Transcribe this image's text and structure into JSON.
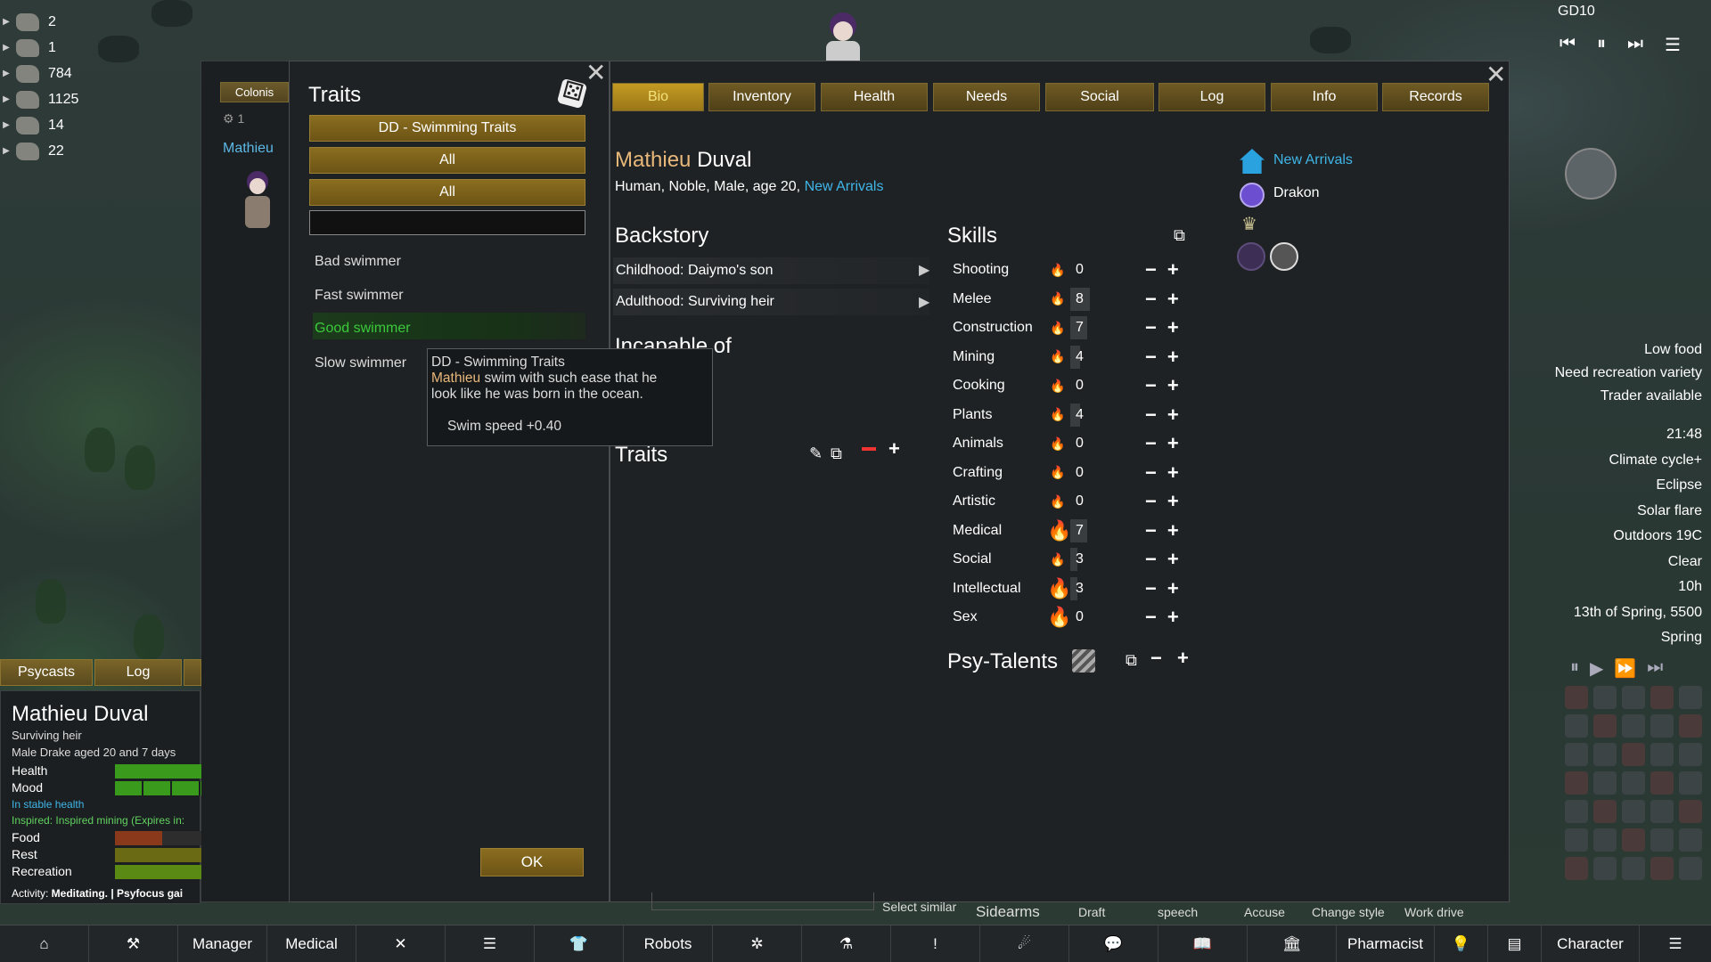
{
  "resources": [
    {
      "icon": "food-icon",
      "value": "2"
    },
    {
      "icon": "wood-icon",
      "value": "1"
    },
    {
      "icon": "bone-icon",
      "value": "784"
    },
    {
      "icon": "stone-icon",
      "value": "1125"
    },
    {
      "icon": "medicine-icon",
      "value": "14"
    },
    {
      "icon": "leather-icon",
      "value": "22"
    }
  ],
  "top_right": {
    "code": "GD10"
  },
  "colonist_panel": {
    "tab": "Colonis",
    "count": "1",
    "name": "Mathieu"
  },
  "traits_window": {
    "title": "Traits",
    "filter_buttons": [
      "DD - Swimming Traits",
      "All",
      "All"
    ],
    "search_value": "",
    "items": [
      "Bad swimmer",
      "Fast swimmer",
      "Good swimmer",
      "Slow swimmer"
    ],
    "selected_item": "Good swimmer",
    "ok_label": "OK"
  },
  "tooltip": {
    "header": "DD - Swimming Traits",
    "name": "Mathieu",
    "text_rest": " swim with such ease that he",
    "line2": "look like he was born in the ocean.",
    "stat": "Swim speed +0.40"
  },
  "bio": {
    "tabs": [
      "Bio",
      "Inventory",
      "Health",
      "Needs",
      "Social",
      "Log",
      "Info",
      "Records"
    ],
    "active_tab": "Bio",
    "first_name": "Mathieu",
    "last_name": "Duval",
    "description": "Human, Noble, Male, age 20, ",
    "faction_link": "New Arrivals",
    "backstory_title": "Backstory",
    "childhood": "Childhood: Daiymo's son",
    "adulthood": "Adulthood: Surviving heir",
    "incapable_title": "Incapable of",
    "traits_title": "Traits",
    "skills_title": "Skills",
    "skills": [
      {
        "name": "Shooting",
        "passion": "minor",
        "level": "0"
      },
      {
        "name": "Melee",
        "passion": "minor",
        "level": "8"
      },
      {
        "name": "Construction",
        "passion": "minor",
        "level": "7"
      },
      {
        "name": "Mining",
        "passion": "minor",
        "level": "4"
      },
      {
        "name": "Cooking",
        "passion": "minor",
        "level": "0"
      },
      {
        "name": "Plants",
        "passion": "minor",
        "level": "4"
      },
      {
        "name": "Animals",
        "passion": "minor",
        "level": "0"
      },
      {
        "name": "Crafting",
        "passion": "minor",
        "level": "0"
      },
      {
        "name": "Artistic",
        "passion": "minor",
        "level": "0"
      },
      {
        "name": "Medical",
        "passion": "major",
        "level": "7"
      },
      {
        "name": "Social",
        "passion": "minor",
        "level": "3"
      },
      {
        "name": "Intellectual",
        "passion": "major",
        "level": "3"
      },
      {
        "name": "Sex",
        "passion": "major",
        "level": "0"
      }
    ],
    "psy_title": "Psy-Talents",
    "faction": "New Arrivals",
    "ideology": "Drakon"
  },
  "status": {
    "tabs": [
      "Psycasts",
      "Log"
    ],
    "name": "Mathieu Duval",
    "title": "Surviving heir",
    "desc": "Male Drake aged 20 and 7 days",
    "needs": [
      {
        "label": "Health",
        "level": 1.0,
        "color": "#3a9a1c"
      },
      {
        "label": "Mood",
        "level": 1.0,
        "color": "#3a9a1c"
      }
    ],
    "health_state": "In stable health",
    "inspired": "Inspired: Inspired mining (Expires in:",
    "needs2": [
      {
        "label": "Food",
        "level": 0.55,
        "color": "#8a3a1a"
      },
      {
        "label": "Rest",
        "level": 1.0,
        "color": "#6a6a14"
      },
      {
        "label": "Recreation",
        "level": 1.0,
        "color": "#5a8a14"
      }
    ],
    "activity_label": "Activity: ",
    "activity": "Meditating. | Psyfocus gai"
  },
  "alerts": [
    "Low food",
    "Need recreation variety",
    "Trader available"
  ],
  "clock": {
    "time": "21:48",
    "conditions": [
      "Climate cycle+",
      "Eclipse",
      "Solar flare",
      "Outdoors 19C",
      "Clear"
    ],
    "hours": "10h",
    "date": "13th of Spring, 5500",
    "season": "Spring"
  },
  "orders": [
    "Select similar",
    "Sidearms",
    "Draft",
    "speech",
    "Accuse",
    "Change style",
    "Work drive"
  ],
  "bottom_bar": [
    "Manager",
    "Medical",
    "Robots",
    "Pharmacist",
    "Character"
  ]
}
